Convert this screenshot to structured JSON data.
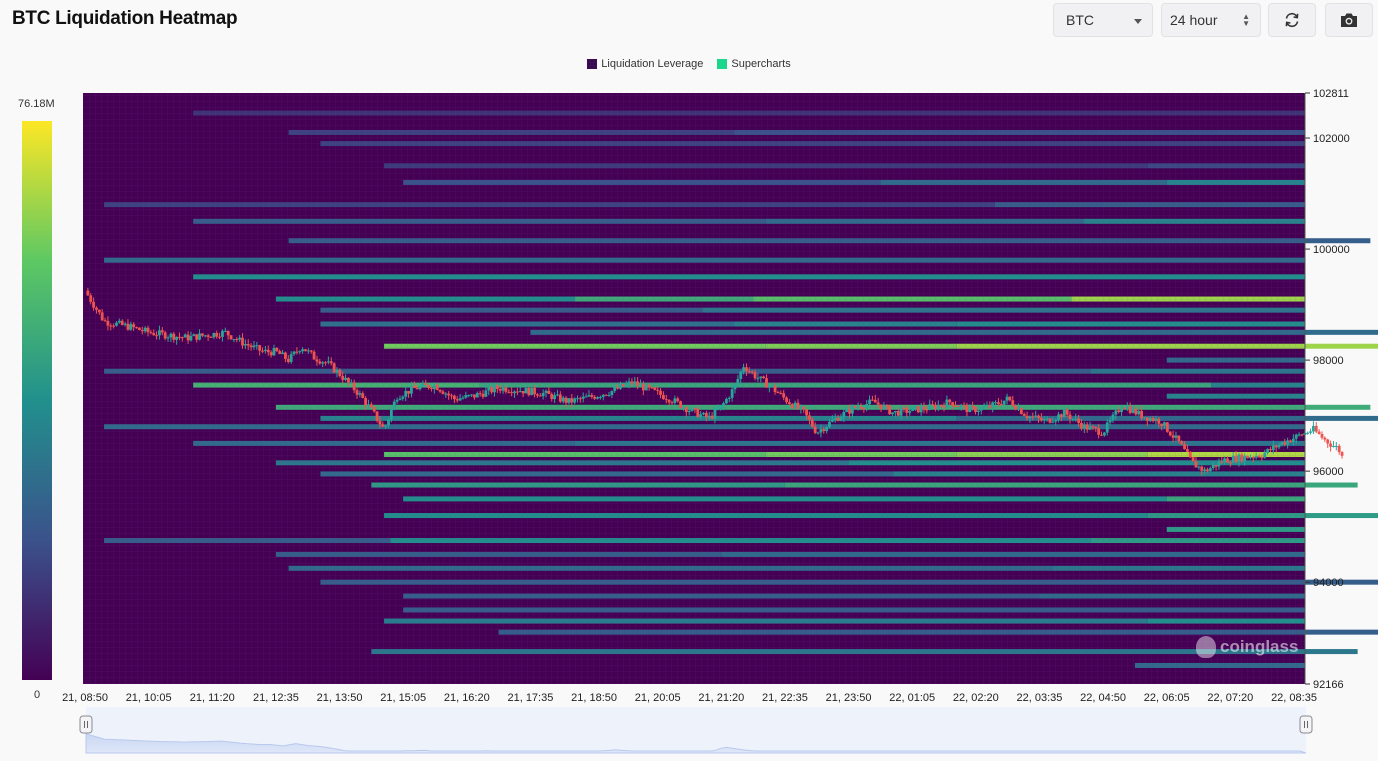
{
  "header": {
    "title": "BTC Liquidation Heatmap",
    "symbol_select": "BTC",
    "range_select": "24 hour",
    "refresh_icon": "refresh-icon",
    "camera_icon": "camera-icon"
  },
  "legend": [
    {
      "label": "Liquidation Leverage",
      "color": "#3b0a53"
    },
    {
      "label": "Supercharts",
      "color": "#1cd68c"
    }
  ],
  "colorbar": {
    "max_label": "76.18M",
    "min_label": "0"
  },
  "watermark": "coinglass",
  "chart_data": {
    "type": "heatmap",
    "title": "BTC Liquidation Heatmap",
    "y_range": [
      92166,
      102811
    ],
    "y_ticks": [
      "102811",
      "102000",
      "100000",
      "98000",
      "96000",
      "94000",
      "92166"
    ],
    "x_ticks": [
      "21, 08:50",
      "21, 10:05",
      "21, 11:20",
      "21, 12:35",
      "21, 13:50",
      "21, 15:05",
      "21, 16:20",
      "21, 17:35",
      "21, 18:50",
      "21, 20:05",
      "21, 21:20",
      "21, 22:35",
      "21, 23:50",
      "22, 01:05",
      "22, 02:20",
      "22, 03:35",
      "22, 04:50",
      "22, 06:05",
      "22, 07:20",
      "22, 08:35"
    ],
    "colorscale": {
      "min": 0,
      "max": "76.18M"
    },
    "bands": [
      {
        "price": 102450,
        "start": 1.7,
        "segments": [
          [
            0.0,
            0.15
          ]
        ]
      },
      {
        "price": 102100,
        "start": 3.2,
        "segments": [
          [
            0.0,
            0.2
          ],
          [
            7.0,
            0.25
          ]
        ]
      },
      {
        "price": 101900,
        "start": 3.7,
        "segments": [
          [
            0.0,
            0.2
          ]
        ]
      },
      {
        "price": 101500,
        "start": 4.7,
        "segments": [
          [
            0.0,
            0.18
          ],
          [
            12.0,
            0.22
          ]
        ]
      },
      {
        "price": 101200,
        "start": 5.0,
        "segments": [
          [
            0.0,
            0.25
          ],
          [
            7.5,
            0.35
          ],
          [
            12.0,
            0.45
          ]
        ]
      },
      {
        "price": 100800,
        "start": 0.3,
        "segments": [
          [
            0.0,
            0.2
          ],
          [
            14.0,
            0.3
          ]
        ]
      },
      {
        "price": 100500,
        "start": 1.7,
        "segments": [
          [
            0.0,
            0.3
          ],
          [
            9.0,
            0.35
          ],
          [
            14.0,
            0.45
          ]
        ]
      },
      {
        "price": 100150,
        "start": 3.2,
        "segments": [
          [
            0.0,
            0.3
          ],
          [
            17.0,
            0.45
          ]
        ]
      },
      {
        "price": 99800,
        "start": 0.3,
        "segments": [
          [
            0.0,
            0.35
          ]
        ]
      },
      {
        "price": 99500,
        "start": 1.7,
        "segments": [
          [
            0.0,
            0.5
          ]
        ]
      },
      {
        "price": 99100,
        "start": 3.0,
        "segments": [
          [
            0.0,
            0.5
          ],
          [
            4.7,
            0.62
          ],
          [
            7.5,
            0.72
          ],
          [
            12.5,
            0.85
          ]
        ]
      },
      {
        "price": 98900,
        "start": 3.7,
        "segments": [
          [
            0.0,
            0.3
          ],
          [
            6.0,
            0.4
          ]
        ]
      },
      {
        "price": 98650,
        "start": 3.7,
        "segments": [
          [
            0.0,
            0.38
          ],
          [
            6.5,
            0.45
          ],
          [
            10.0,
            0.5
          ]
        ]
      },
      {
        "price": 98500,
        "start": 7.0,
        "segments": [
          [
            0.0,
            0.35
          ],
          [
            16.5,
            0.5
          ]
        ]
      },
      {
        "price": 98250,
        "start": 4.7,
        "segments": [
          [
            0.0,
            0.78
          ],
          [
            6.0,
            0.8
          ],
          [
            9.0,
            0.85
          ],
          [
            17.0,
            0.95
          ]
        ]
      },
      {
        "price": 98000,
        "start": 17.0,
        "segments": [
          [
            0.0,
            0.35
          ]
        ]
      },
      {
        "price": 97800,
        "start": 0.3,
        "segments": [
          [
            0.0,
            0.3
          ],
          [
            15.5,
            0.4
          ]
        ]
      },
      {
        "price": 97550,
        "start": 1.7,
        "segments": [
          [
            0.0,
            0.65
          ],
          [
            4.5,
            0.6
          ],
          [
            16.0,
            0.45
          ]
        ]
      },
      {
        "price": 97350,
        "start": 17.0,
        "segments": [
          [
            0.0,
            0.45
          ]
        ]
      },
      {
        "price": 97150,
        "start": 3.0,
        "segments": [
          [
            0.0,
            0.62
          ],
          [
            17.2,
            0.55
          ]
        ]
      },
      {
        "price": 96950,
        "start": 3.7,
        "segments": [
          [
            0.0,
            0.45
          ],
          [
            10.0,
            0.35
          ],
          [
            17.0,
            0.6
          ]
        ]
      },
      {
        "price": 96800,
        "start": 0.3,
        "segments": [
          [
            0.0,
            0.35
          ]
        ]
      },
      {
        "price": 96500,
        "start": 1.7,
        "segments": [
          [
            0.0,
            0.35
          ],
          [
            6.0,
            0.4
          ]
        ]
      },
      {
        "price": 96300,
        "start": 4.7,
        "segments": [
          [
            0.0,
            0.72
          ],
          [
            6.0,
            0.78
          ],
          [
            9.0,
            0.82
          ],
          [
            12.0,
            0.88
          ]
        ]
      },
      {
        "price": 96150,
        "start": 3.0,
        "segments": [
          [
            0.0,
            0.4
          ],
          [
            9.0,
            0.5
          ]
        ]
      },
      {
        "price": 95950,
        "start": 3.7,
        "segments": [
          [
            0.0,
            0.35
          ],
          [
            9.0,
            0.45
          ]
        ]
      },
      {
        "price": 95750,
        "start": 4.5,
        "segments": [
          [
            0.0,
            0.55
          ],
          [
            6.5,
            0.6
          ],
          [
            15.5,
            0.85
          ]
        ]
      },
      {
        "price": 95500,
        "start": 5.0,
        "segments": [
          [
            0.0,
            0.5
          ],
          [
            12.0,
            0.6
          ]
        ]
      },
      {
        "price": 95200,
        "start": 4.7,
        "segments": [
          [
            0.0,
            0.5
          ],
          [
            12.0,
            0.55
          ],
          [
            17.0,
            0.7
          ]
        ]
      },
      {
        "price": 94950,
        "start": 17.0,
        "segments": [
          [
            0.0,
            0.55
          ]
        ]
      },
      {
        "price": 94750,
        "start": 0.3,
        "segments": [
          [
            0.0,
            0.3
          ],
          [
            4.5,
            0.5
          ],
          [
            15.5,
            0.55
          ]
        ]
      },
      {
        "price": 94500,
        "start": 3.0,
        "segments": [
          [
            0.0,
            0.3
          ],
          [
            7.0,
            0.35
          ]
        ]
      },
      {
        "price": 94250,
        "start": 3.2,
        "segments": [
          [
            0.0,
            0.35
          ],
          [
            12.0,
            0.4
          ]
        ]
      },
      {
        "price": 94000,
        "start": 3.7,
        "segments": [
          [
            0.0,
            0.3
          ],
          [
            17.0,
            0.45
          ]
        ]
      },
      {
        "price": 93750,
        "start": 5.0,
        "segments": [
          [
            0.0,
            0.3
          ],
          [
            10.0,
            0.35
          ]
        ]
      },
      {
        "price": 93500,
        "start": 5.0,
        "segments": [
          [
            0.0,
            0.3
          ]
        ]
      },
      {
        "price": 93300,
        "start": 4.7,
        "segments": [
          [
            0.0,
            0.42
          ],
          [
            12.0,
            0.5
          ]
        ]
      },
      {
        "price": 93100,
        "start": 6.5,
        "segments": [
          [
            0.0,
            0.3
          ],
          [
            14.0,
            0.4
          ]
        ]
      },
      {
        "price": 92750,
        "start": 4.5,
        "segments": [
          [
            0.0,
            0.4
          ],
          [
            15.5,
            0.45
          ]
        ]
      },
      {
        "price": 92500,
        "start": 16.5,
        "segments": [
          [
            0.0,
            0.35
          ]
        ]
      }
    ],
    "price_path": [
      [
        0,
        99250
      ],
      [
        0.3,
        98700
      ],
      [
        0.7,
        98600
      ],
      [
        1.0,
        98500
      ],
      [
        1.3,
        98450
      ],
      [
        1.6,
        98400
      ],
      [
        1.9,
        98450
      ],
      [
        2.2,
        98500
      ],
      [
        2.5,
        98300
      ],
      [
        2.8,
        98150
      ],
      [
        3.0,
        98150
      ],
      [
        3.2,
        98000
      ],
      [
        3.4,
        98250
      ],
      [
        3.6,
        98050
      ],
      [
        3.8,
        97950
      ],
      [
        4.0,
        97750
      ],
      [
        4.3,
        97400
      ],
      [
        4.5,
        97100
      ],
      [
        4.7,
        96750
      ],
      [
        4.9,
        97350
      ],
      [
        5.2,
        97500
      ],
      [
        5.5,
        97550
      ],
      [
        5.8,
        97300
      ],
      [
        6.1,
        97350
      ],
      [
        6.5,
        97500
      ],
      [
        6.9,
        97450
      ],
      [
        7.2,
        97400
      ],
      [
        7.6,
        97250
      ],
      [
        8.0,
        97350
      ],
      [
        8.3,
        97450
      ],
      [
        8.6,
        97600
      ],
      [
        8.9,
        97450
      ],
      [
        9.2,
        97300
      ],
      [
        9.5,
        97100
      ],
      [
        9.8,
        96950
      ],
      [
        10.0,
        97150
      ],
      [
        10.2,
        97500
      ],
      [
        10.35,
        97900
      ],
      [
        10.55,
        97700
      ],
      [
        10.8,
        97500
      ],
      [
        11.0,
        97300
      ],
      [
        11.3,
        97050
      ],
      [
        11.5,
        96700
      ],
      [
        11.8,
        96950
      ],
      [
        12.1,
        97150
      ],
      [
        12.4,
        97250
      ],
      [
        12.7,
        97050
      ],
      [
        13.0,
        97100
      ],
      [
        13.3,
        97150
      ],
      [
        13.6,
        97250
      ],
      [
        13.9,
        97100
      ],
      [
        14.2,
        97150
      ],
      [
        14.5,
        97300
      ],
      [
        14.8,
        97000
      ],
      [
        15.1,
        96900
      ],
      [
        15.4,
        97050
      ],
      [
        15.7,
        96800
      ],
      [
        16.0,
        96700
      ],
      [
        16.3,
        97200
      ],
      [
        16.6,
        97000
      ],
      [
        16.9,
        96900
      ],
      [
        17.2,
        96500
      ],
      [
        17.4,
        96150
      ],
      [
        17.6,
        96000
      ],
      [
        17.9,
        96200
      ],
      [
        18.2,
        96250
      ],
      [
        18.5,
        96300
      ],
      [
        18.8,
        96500
      ],
      [
        19.0,
        96600
      ],
      [
        19.3,
        96750
      ],
      [
        19.5,
        96550
      ],
      [
        19.7,
        96400
      ],
      [
        19.8,
        96150
      ]
    ],
    "navigator_range": [
      0,
      19.8
    ]
  }
}
